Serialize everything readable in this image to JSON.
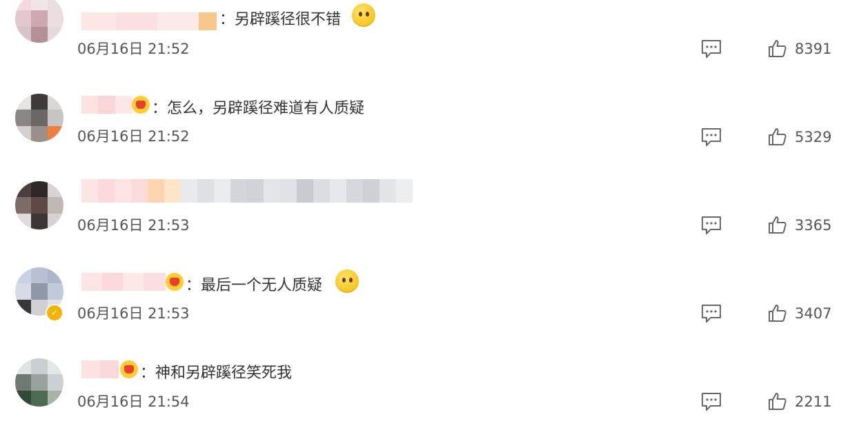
{
  "comments": [
    {
      "text": "：另辟蹊径很不错",
      "time": "06月16日 21:52",
      "likes": "8391"
    },
    {
      "text": "：怎么，另辟蹊径难道有人质疑",
      "time": "06月16日 21:52",
      "likes": "5329"
    },
    {
      "text": "",
      "time": "06月16日 21:53",
      "likes": "3365"
    },
    {
      "text": "：最后一个无人质疑",
      "time": "06月16日 21:53",
      "likes": "3407"
    },
    {
      "text": "：神和另辟蹊径笑死我",
      "time": "06月16日 21:54",
      "likes": "2211"
    }
  ],
  "colors": {
    "text": "#333333",
    "meta": "#555555",
    "icon": "#666666",
    "badge": "#f6b300"
  },
  "icons": {
    "comment": "comment-icon",
    "like": "thumbs-up-icon",
    "verified": "verified-badge-icon"
  }
}
